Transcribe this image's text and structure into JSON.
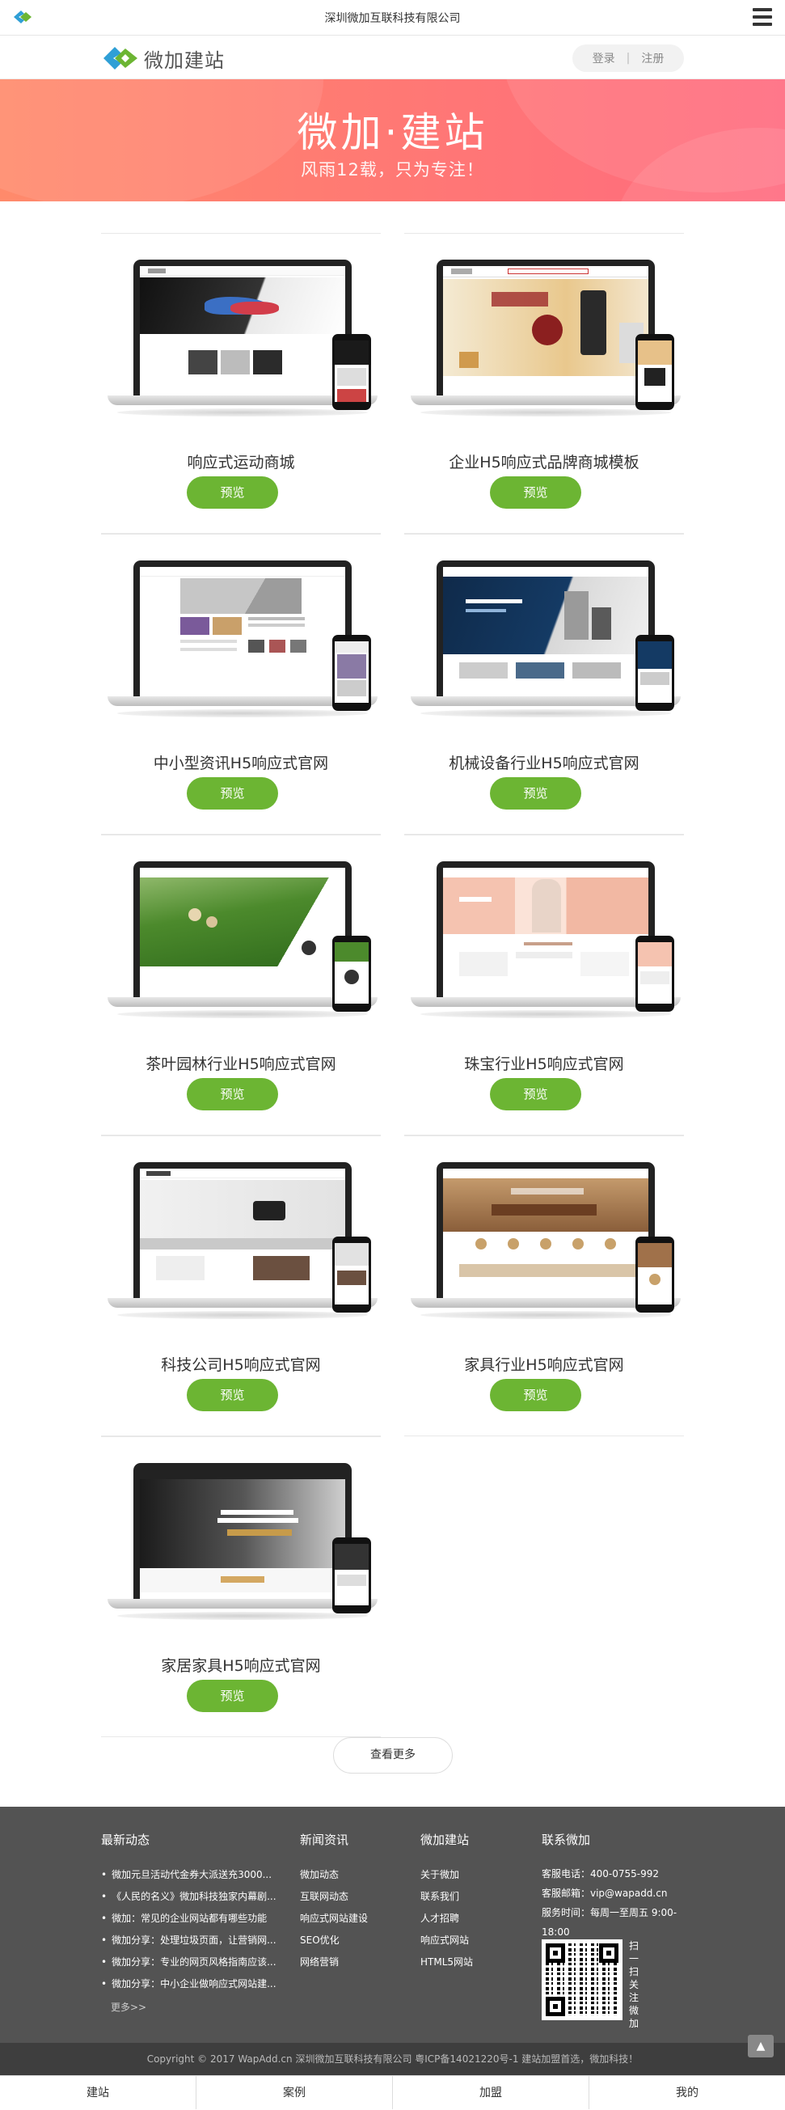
{
  "topbar": {
    "title": "深圳微加互联科技有限公司"
  },
  "header": {
    "logo_text": "微加建站",
    "login": "登录",
    "separator": "|",
    "register": "注册"
  },
  "banner": {
    "title": "微加·建站",
    "subtitle": "风雨12载，只为专注！"
  },
  "templates": [
    {
      "title": "响应式运动商城",
      "button": "预览"
    },
    {
      "title": "企业H5响应式品牌商城模板",
      "button": "预览"
    },
    {
      "title": "中小型资讯H5响应式官网",
      "button": "预览"
    },
    {
      "title": "机械设备行业H5响应式官网",
      "button": "预览"
    },
    {
      "title": "茶叶园林行业H5响应式官网",
      "button": "预览"
    },
    {
      "title": "珠宝行业H5响应式官网",
      "button": "预览"
    },
    {
      "title": "科技公司H5响应式官网",
      "button": "预览"
    },
    {
      "title": "家具行业H5响应式官网",
      "button": "预览"
    },
    {
      "title": "家居家具H5响应式官网",
      "button": "预览"
    }
  ],
  "more_button": "查看更多",
  "footer": {
    "news": {
      "heading": "最新动态",
      "items": [
        "微加元旦活动代金券大派送充3000...",
        "《人民的名义》微加科技独家内幕剧...",
        "微加：常见的企业网站都有哪些功能",
        "微加分享：处理垃圾页面，让营销网...",
        "微加分享：专业的网页风格指南应该...",
        "微加分享：中小企业做响应式网站建..."
      ],
      "more": "更多>>"
    },
    "info": {
      "heading": "新闻资讯",
      "items": [
        "微加动态",
        "互联网动态",
        "响应式网站建设",
        "SEO优化",
        "网络营销"
      ]
    },
    "weijia": {
      "heading": "微加建站",
      "items": [
        "关于微加",
        "联系我们",
        "人才招聘",
        "响应式网站",
        "HTML5网站"
      ]
    },
    "contact": {
      "heading": "联系微加",
      "phone": "客服电话：400-0755-992",
      "email": "客服邮箱：vip@wapadd.cn",
      "hours": "服务时间：每周一至周五 9:00-18:00",
      "qr_label": "扫一扫关注微加"
    },
    "copyright": "Copyright © 2017 WapAdd.cn 深圳微加互联科技有限公司 粤ICP备14021220号-1 建站加盟首选，微加科技！"
  },
  "totop_icon": "arrow-up-icon",
  "bottom_nav": [
    "建站",
    "案例",
    "加盟",
    "我的"
  ],
  "colors": {
    "accent_green": "#6cb533",
    "banner_start": "#ff8a6b",
    "banner_end": "#ff6a7f",
    "footer_bg": "#535353"
  }
}
